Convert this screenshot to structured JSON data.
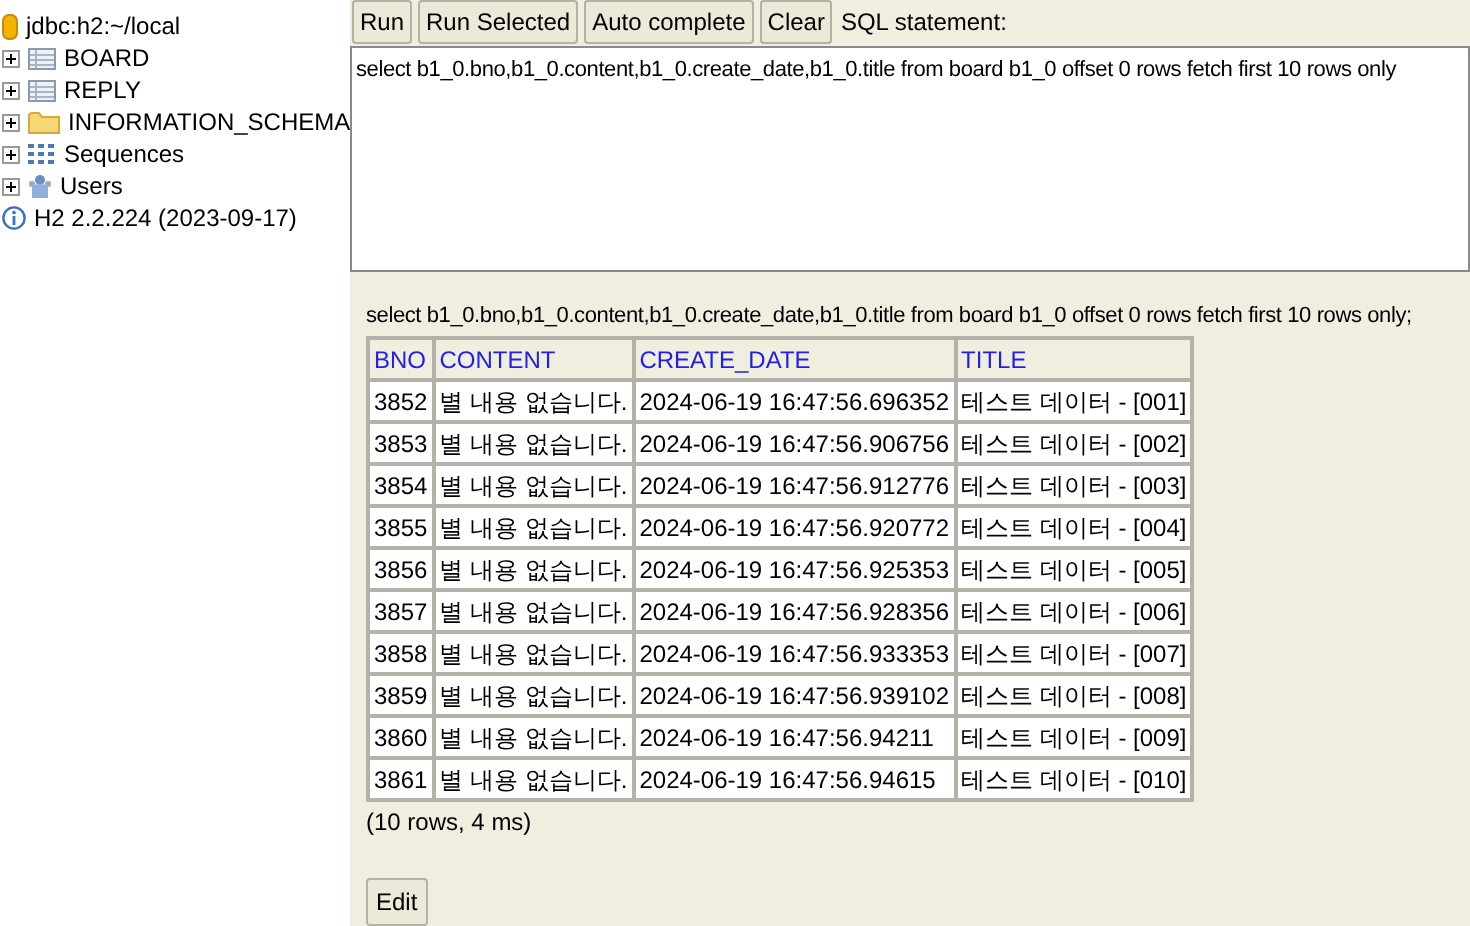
{
  "tree": {
    "root": {
      "kind": "database",
      "label": "jdbc:h2:~/local"
    },
    "items": [
      {
        "kind": "table",
        "label": "BOARD",
        "expanded": false
      },
      {
        "kind": "table",
        "label": "REPLY",
        "expanded": false
      },
      {
        "kind": "folder",
        "label": "INFORMATION_SCHEMA",
        "expanded": false
      },
      {
        "kind": "sequences",
        "label": "Sequences",
        "expanded": false
      },
      {
        "kind": "users",
        "label": "Users",
        "expanded": false
      }
    ],
    "version": {
      "kind": "info",
      "label": "H2 2.2.224 (2023-09-17)"
    }
  },
  "toolbar": {
    "buttons": [
      "Run",
      "Run Selected",
      "Auto complete",
      "Clear"
    ],
    "label": "SQL statement:"
  },
  "editor": {
    "value": "select b1_0.bno,b1_0.content,b1_0.create_date,b1_0.title from board b1_0 offset 0 rows fetch first 10 rows only"
  },
  "result": {
    "statement": "select b1_0.bno,b1_0.content,b1_0.create_date,b1_0.title from board b1_0 offset 0 rows fetch first 10 rows only;",
    "table": {
      "columns": [
        "BNO",
        "CONTENT",
        "CREATE_DATE",
        "TITLE"
      ],
      "rows": [
        [
          "3852",
          "별 내용 없습니다.",
          "2024-06-19 16:47:56.696352",
          "테스트 데이터 - [001]"
        ],
        [
          "3853",
          "별 내용 없습니다.",
          "2024-06-19 16:47:56.906756",
          "테스트 데이터 - [002]"
        ],
        [
          "3854",
          "별 내용 없습니다.",
          "2024-06-19 16:47:56.912776",
          "테스트 데이터 - [003]"
        ],
        [
          "3855",
          "별 내용 없습니다.",
          "2024-06-19 16:47:56.920772",
          "테스트 데이터 - [004]"
        ],
        [
          "3856",
          "별 내용 없습니다.",
          "2024-06-19 16:47:56.925353",
          "테스트 데이터 - [005]"
        ],
        [
          "3857",
          "별 내용 없습니다.",
          "2024-06-19 16:47:56.928356",
          "테스트 데이터 - [006]"
        ],
        [
          "3858",
          "별 내용 없습니다.",
          "2024-06-19 16:47:56.933353",
          "테스트 데이터 - [007]"
        ],
        [
          "3859",
          "별 내용 없습니다.",
          "2024-06-19 16:47:56.939102",
          "테스트 데이터 - [008]"
        ],
        [
          "3860",
          "별 내용 없습니다.",
          "2024-06-19 16:47:56.94211",
          "테스트 데이터 - [009]"
        ],
        [
          "3861",
          "별 내용 없습니다.",
          "2024-06-19 16:47:56.94615",
          "테스트 데이터 - [010]"
        ]
      ]
    },
    "summary": "(10 rows, 4 ms)",
    "buttons": [
      "Edit"
    ]
  }
}
